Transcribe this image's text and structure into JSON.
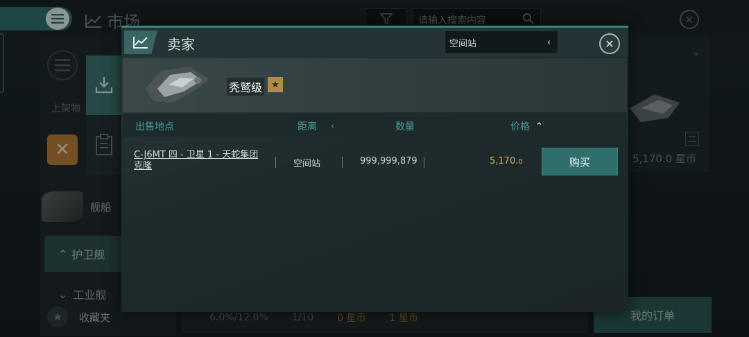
{
  "background": {
    "title": "市场",
    "search_placeholder": "请输入搜索内容",
    "shelf_text": "上架物",
    "category_ships": "舰船",
    "category_frigate": "护卫舰",
    "category_industrial": "工业舰",
    "favorites": "收藏夹",
    "bottom_bar": {
      "ratio": "6.0%/12.0%",
      "slots": "1/10",
      "coins_a": "0 星币",
      "coins_b": "1 星币"
    },
    "right_card": {
      "badge": "二",
      "price": "5,170.0 星币"
    },
    "orders_button": "我的订单"
  },
  "modal": {
    "title": "卖家",
    "location_select": "空间站",
    "ship": {
      "name": "秃鹫级",
      "star": "★"
    },
    "columns": {
      "location": "出售地点",
      "distance": "距离",
      "quantity": "数量",
      "price": "价格"
    },
    "rows": [
      {
        "location": "C-J6MT 四 - 卫星 1 - 天蛇集团 克隆",
        "distance": "空间站",
        "quantity": "999,999,879",
        "price_main": "5,170.",
        "price_decimal": "0",
        "buy": "购买"
      }
    ]
  },
  "colors": {
    "accent": "#3a8580",
    "buy_button": "#2f6f6b",
    "price": "#d8ad5a",
    "column_header": "#4a9b98"
  }
}
